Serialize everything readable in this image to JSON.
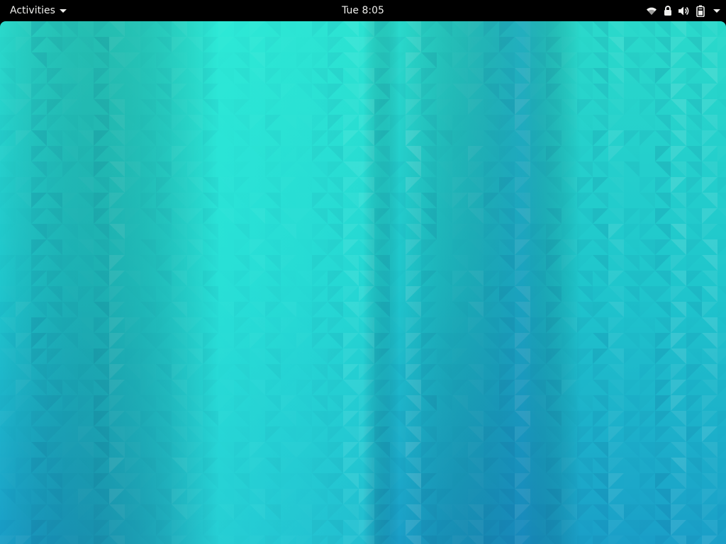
{
  "topbar": {
    "activities_label": "Activities",
    "clock": "Tue 8:05",
    "status_icons": [
      "wifi-icon",
      "vpn-lock-icon",
      "volume-icon",
      "battery-icon"
    ],
    "background": "#000000",
    "text_color": "#eeeeec"
  },
  "desktop": {
    "wallpaper": "teal-triangle-mosaic",
    "colors": [
      "#1fd4c9",
      "#2ee8d8",
      "#1aa9c9",
      "#157fb8"
    ]
  }
}
